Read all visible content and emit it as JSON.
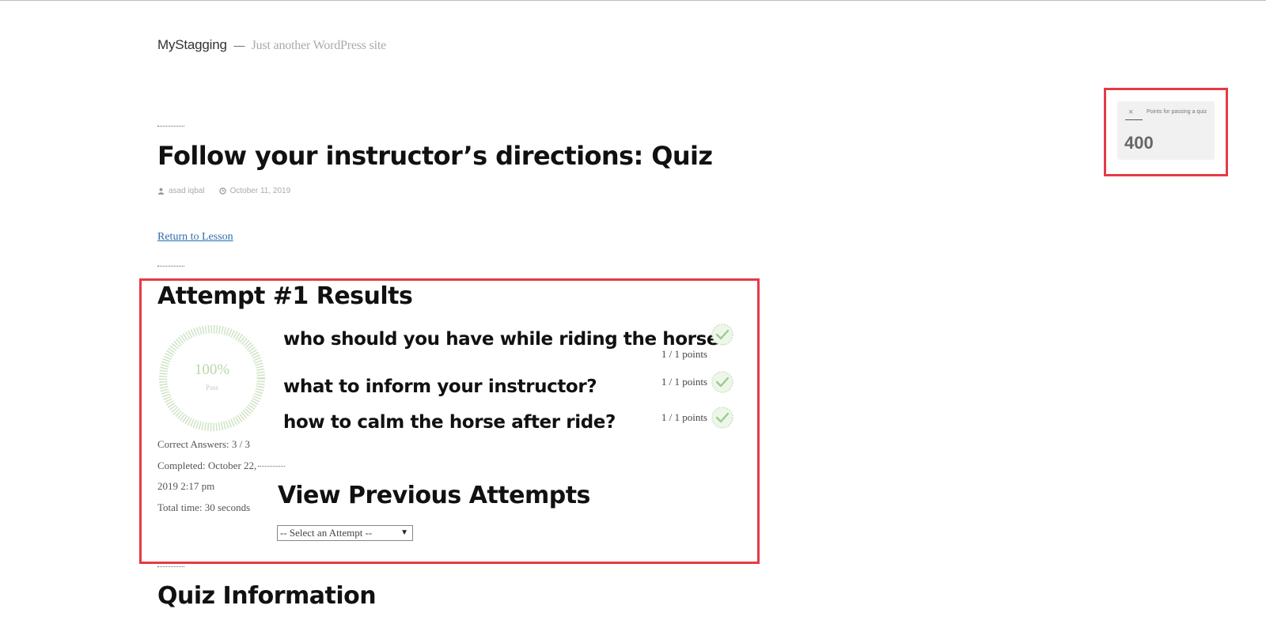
{
  "site": {
    "title": "MyStagging",
    "separator": "—",
    "tagline": "Just another WordPress site"
  },
  "post": {
    "title": "Follow your instructor’s directions: Quiz",
    "author": "asad iqbal",
    "date": "October 11, 2019",
    "return_link": "Return to Lesson"
  },
  "attempt": {
    "title": "Attempt #1 Results",
    "score_percent": "100%",
    "score_status": "Pass",
    "correct_answers": "Correct Answers: 3 / 3",
    "completed_line1": "Completed: October 22,",
    "completed_line2": "2019 2:17 pm",
    "total_time": "Total time: 30 seconds",
    "questions": [
      {
        "text": "who should you have while riding the horse?",
        "points": "1 / 1 points",
        "correct": true
      },
      {
        "text": "what to inform your instructor?",
        "points": "1 / 1 points",
        "correct": true
      },
      {
        "text": "how to calm the horse after ride?",
        "points": "1 / 1 points",
        "correct": true
      }
    ]
  },
  "previous_attempts": {
    "title": "View Previous Attempts",
    "select_value": "-- Select an Attempt --"
  },
  "quiz_info": {
    "title": "Quiz Information"
  },
  "points_widget": {
    "close_symbol": "×",
    "label": "Points for passing a quiz",
    "value": "400"
  },
  "colors": {
    "highlight_border": "#e63a46",
    "link": "#2a6db0",
    "score_green": "#b8d8a9",
    "check_green": "#9ccc8a"
  }
}
